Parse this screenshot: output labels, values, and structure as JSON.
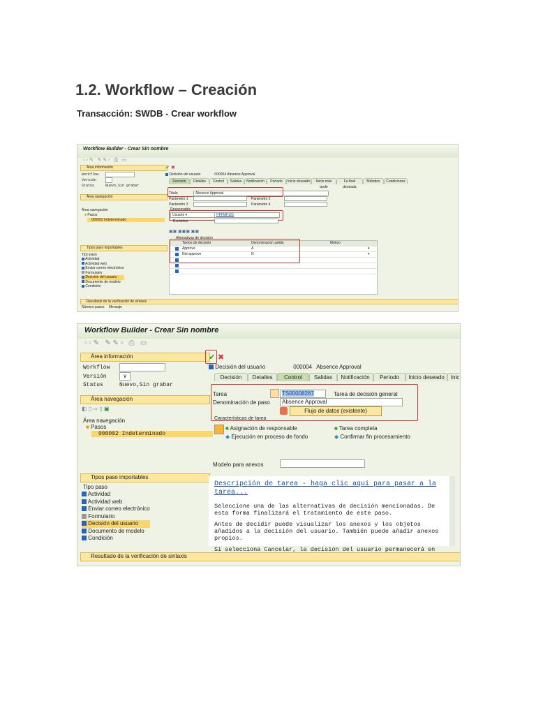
{
  "heading": "1.2. Workflow – Creación",
  "subheading": "Transacción: SWDB - Crear workflow",
  "shot1": {
    "title": "Workflow Builder - Crear Sin nombre",
    "area_info": "Área información",
    "workflow_label": "Workflow",
    "version_label": "Versión",
    "status_label": "Status",
    "status_value": "Nuevo,Sin grabar",
    "area_nav": "Área navegación",
    "nav_header": "Área navegación",
    "pasos": "Pasos",
    "step": "000002 Indeterminado",
    "tipos": "Tipos paso importables",
    "tipo_paso": "Tipo paso",
    "types": [
      "Actividad",
      "Actividad web",
      "Enviar correo electrónico",
      "Formulario",
      "Decisión del usuario",
      "Documento de modelo",
      "Condición"
    ],
    "step_type": "Decisión del usuario",
    "step_num": "000004",
    "step_name": "Absence Approval",
    "tabs": [
      "Decisión",
      "Detalles",
      "Control",
      "Salidas",
      "Notificación",
      "Período",
      "Inicio deseado",
      "Inicio más tarde",
      "Fe.final deseada",
      "Métodos",
      "Condiciones"
    ],
    "titulo_label": "Título",
    "titulo_value": "Absence Approval",
    "p1": "Parámetro 1",
    "p2": "Parámetro 2",
    "p3": "Parámetro 3",
    "p4": "Parámetro 4",
    "responsable": "Responsable",
    "resp_type": "Usuario",
    "resp_value": "HFFMF101",
    "excluidos": "Excluidos",
    "alt_title": "Alternativas de decisión",
    "cols": [
      "Textos de decisión",
      "Denominación salida",
      "Motivo"
    ],
    "rows": [
      [
        "Approve",
        "A"
      ],
      [
        "Not approve",
        "N"
      ]
    ],
    "result": "Resultado de la verificación de sintaxis",
    "num_pasos": "Número pasos",
    "mensaje": "Mensaje"
  },
  "shot2": {
    "title": "Workflow Builder - Crear Sin nombre",
    "area_info": "Área información",
    "workflow_label": "Workflow",
    "version_label": "Versión",
    "status_label": "Status",
    "status_value": "Nuevo,Sin grabar",
    "area_nav": "Área navegación",
    "nav_header": "Área navegación",
    "pasos": "Pasos",
    "step": "000002 Indeterminado",
    "tipos": "Tipos paso importables",
    "tipo_paso": "Tipo paso",
    "types": [
      "Actividad",
      "Actividad web",
      "Enviar correo electrónico",
      "Formulario",
      "Decisión del usuario",
      "Documento de modelo",
      "Condición"
    ],
    "step_type": "Decisión del usuario",
    "step_num": "000004",
    "step_name": "Absence Approval",
    "tabs": [
      "Decisión",
      "Detalles",
      "Control",
      "Salidas",
      "Notificación",
      "Período",
      "Inicio deseado",
      "Inic"
    ],
    "tarea_label": "Tarea",
    "tarea_value": "TS00008267",
    "tarea_desc": "Tarea de decisión general",
    "denom_label": "Denominación de paso",
    "denom_value": "Absence Approval",
    "flujo": "Flujo de datos (existente)",
    "caract": "Características de tarea",
    "asignacion": "Asignación de responsable",
    "tarea_completa": "Tarea completa",
    "ejecucion": "Ejecución en proceso de fondo",
    "confirmar": "Confirmar fin procesamiento",
    "modelo": "Modelo para anexos",
    "desc_link": "Descripción de tarea - haga clic aquí para pasar a la tarea...",
    "desc1": "Seleccione una de las alternativas de decisión mencionadas. De esta forma finalizará el tratamiento de este paso.",
    "desc2": "Antes de decidir puede visualizar los anexos y los objetos añadidos a la decisión del usuario. También puede añadir anexos propios.",
    "desc3": "Si selecciona Cancelar, la decisión del usuario permanecerá en la",
    "result": "Resultado de la verificación de sintaxis"
  }
}
